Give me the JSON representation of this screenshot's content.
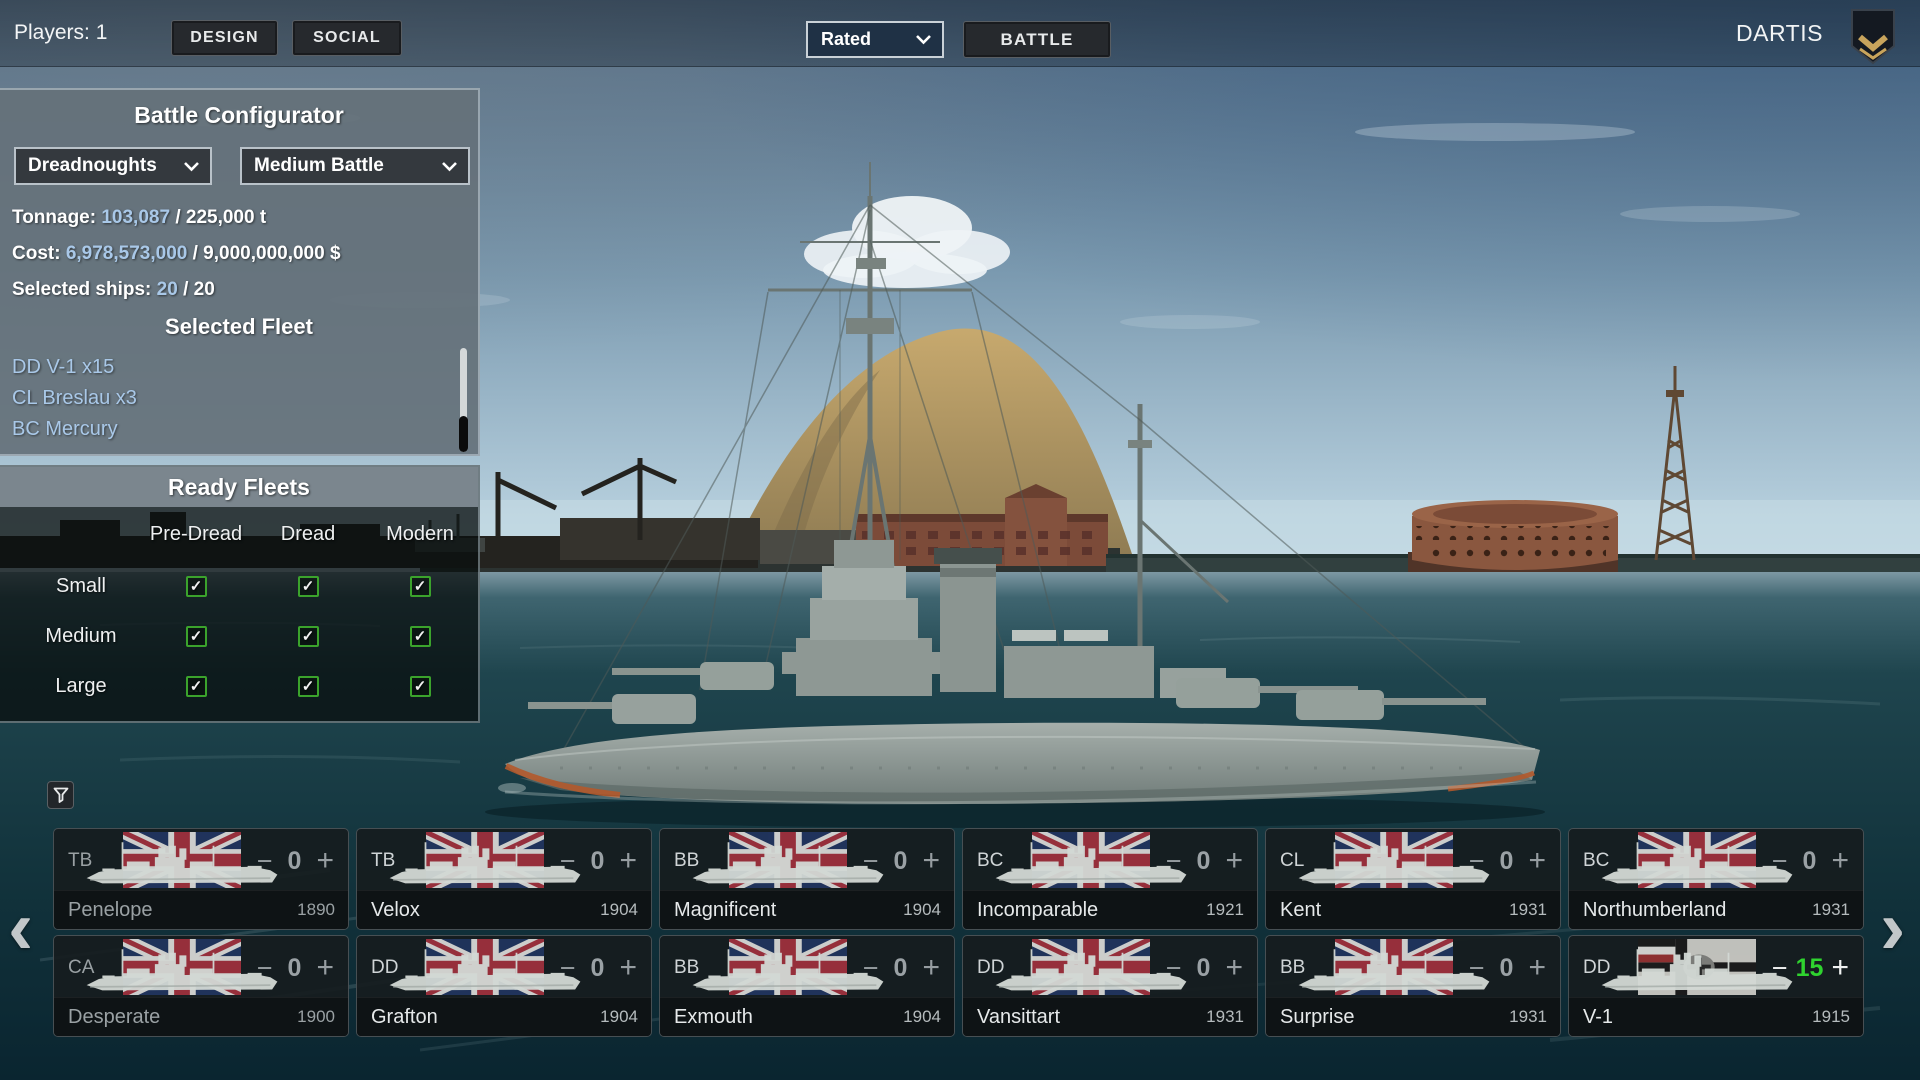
{
  "colors": {
    "accent_blue": "#a9c8e8",
    "count_green": "#2fd32f",
    "checkbox_green": "#3ba32c",
    "rank_gold": "#c8a45c"
  },
  "top_bar": {
    "players": "Players: 1",
    "design": "DESIGN",
    "social": "SOCIAL",
    "match_type": "Rated",
    "battle": "BATTLE",
    "username": "DARTIS",
    "rank_icon": "rank-chevron-badge"
  },
  "battle_configurator": {
    "title": "Battle Configurator",
    "fleet_type_select": "Dreadnoughts",
    "battle_size_select": "Medium Battle",
    "stats": {
      "tonnage_label": "Tonnage: ",
      "tonnage_current": "103,087",
      "tonnage_max": " / 225,000 t",
      "cost_label": "Cost: ",
      "cost_current": "6,978,573,000",
      "cost_max": " / 9,000,000,000 $",
      "ships_label": "Selected ships: ",
      "ships_current": "20",
      "ships_max": " / 20"
    },
    "selected_fleet": {
      "title": "Selected Fleet",
      "items": [
        "DD V-1 x15",
        "CL Breslau x3",
        "BC Mercury"
      ]
    }
  },
  "ready_fleets": {
    "title": "Ready Fleets",
    "check_glyph": "✓",
    "columns": [
      "Pre-Dread",
      "Dread",
      "Modern"
    ],
    "rows": [
      {
        "label": "Small",
        "checks": [
          true,
          true,
          true
        ]
      },
      {
        "label": "Medium",
        "checks": [
          true,
          true,
          true
        ]
      },
      {
        "label": "Large",
        "checks": [
          true,
          true,
          true
        ]
      }
    ]
  },
  "ship_browser": {
    "prev_arrow": "‹",
    "next_arrow": "›",
    "filter_icon": "funnel-icon",
    "minus_glyph": "−",
    "plus_glyph": "+",
    "cards": [
      {
        "type": "TB",
        "name": "Penelope",
        "year": "1890",
        "count": "0",
        "flag": "uk",
        "dim": true,
        "count_active": false
      },
      {
        "type": "TB",
        "name": "Velox",
        "year": "1904",
        "count": "0",
        "flag": "uk",
        "dim": false,
        "count_active": false
      },
      {
        "type": "BB",
        "name": "Magnificent",
        "year": "1904",
        "count": "0",
        "flag": "uk",
        "dim": false,
        "count_active": false
      },
      {
        "type": "BC",
        "name": "Incomparable",
        "year": "1921",
        "count": "0",
        "flag": "uk",
        "dim": false,
        "count_active": false
      },
      {
        "type": "CL",
        "name": "Kent",
        "year": "1931",
        "count": "0",
        "flag": "uk",
        "dim": false,
        "count_active": false
      },
      {
        "type": "BC",
        "name": "Northumberland",
        "year": "1931",
        "count": "0",
        "flag": "uk",
        "dim": false,
        "count_active": false
      },
      {
        "type": "CA",
        "name": "Desperate",
        "year": "1900",
        "count": "0",
        "flag": "uk",
        "dim": true,
        "count_active": false
      },
      {
        "type": "DD",
        "name": "Grafton",
        "year": "1904",
        "count": "0",
        "flag": "uk",
        "dim": false,
        "count_active": false
      },
      {
        "type": "BB",
        "name": "Exmouth",
        "year": "1904",
        "count": "0",
        "flag": "uk",
        "dim": false,
        "count_active": false
      },
      {
        "type": "DD",
        "name": "Vansittart",
        "year": "1931",
        "count": "0",
        "flag": "uk",
        "dim": false,
        "count_active": false
      },
      {
        "type": "BB",
        "name": "Surprise",
        "year": "1931",
        "count": "0",
        "flag": "uk",
        "dim": false,
        "count_active": false
      },
      {
        "type": "DD",
        "name": "V-1",
        "year": "1915",
        "count": "15",
        "flag": "de",
        "dim": false,
        "count_active": true
      }
    ]
  }
}
